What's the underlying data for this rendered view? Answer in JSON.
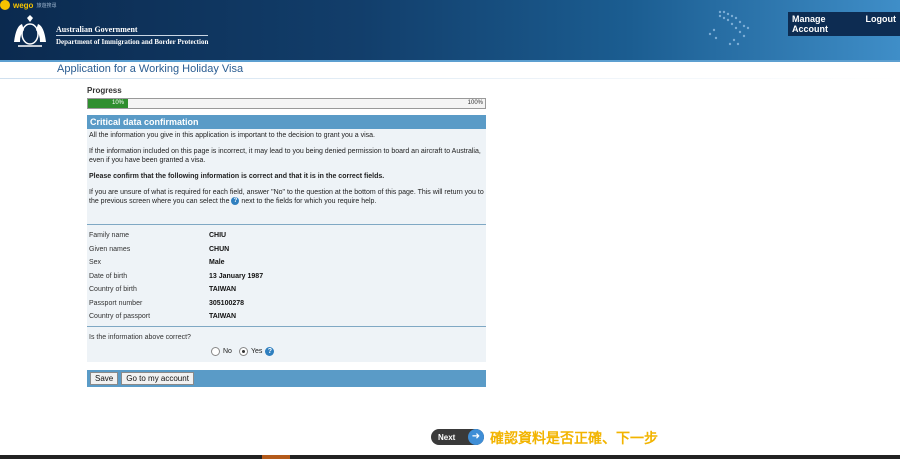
{
  "header": {
    "wego_logo": "wego",
    "wego_sub": "旅遊搜尋",
    "gov_line1": "Australian Government",
    "gov_line2": "Department of Immigration and Border Protection",
    "manage_account": "Manage Account",
    "logout": "Logout"
  },
  "app_title": "Application for a Working Holiday Visa",
  "progress": {
    "label": "Progress",
    "percent": 10,
    "start_label": "10%",
    "end_label": "100%",
    "fill_color": "#2f8f2f"
  },
  "panel": {
    "title": "Critical data confirmation",
    "para1": "All the information you give in this application is important to the decision to grant you a visa.",
    "para2": "If the information included on this page is incorrect, it may lead to you being denied permission to board an aircraft to Australia, even if you have been granted a visa.",
    "para3": "Please confirm that the following information is correct and that it is in the correct fields.",
    "para4_part1": "If you are unsure of what is required for each field, answer \"No\" to the question at the bottom of this page. This will return you to the previous screen where you can select the",
    "para4_part2": "next to the fields for which you require help.",
    "help_icon": "help-icon"
  },
  "fields": [
    {
      "label": "Family name",
      "value": "CHIU"
    },
    {
      "label": "Given names",
      "value": "CHUN"
    },
    {
      "label": "Sex",
      "value": "Male"
    },
    {
      "label": "Date of birth",
      "value": "13 January 1987"
    },
    {
      "label": "Country of birth",
      "value": "TAIWAN"
    },
    {
      "label": "Passport number",
      "value": "305100278"
    },
    {
      "label": "Country of passport",
      "value": "TAIWAN"
    }
  ],
  "question": {
    "text": "Is the information above correct?",
    "no_label": "No",
    "yes_label": "Yes",
    "selected": "Yes"
  },
  "actions": {
    "save": "Save",
    "go_to_account": "Go to my account",
    "next": "Next"
  },
  "annotation": "確認資料是否正確、下一步",
  "colors": {
    "header_dark": "#0b2a4f",
    "panel_head": "#5a9bc7",
    "annotation": "#f2b400"
  }
}
